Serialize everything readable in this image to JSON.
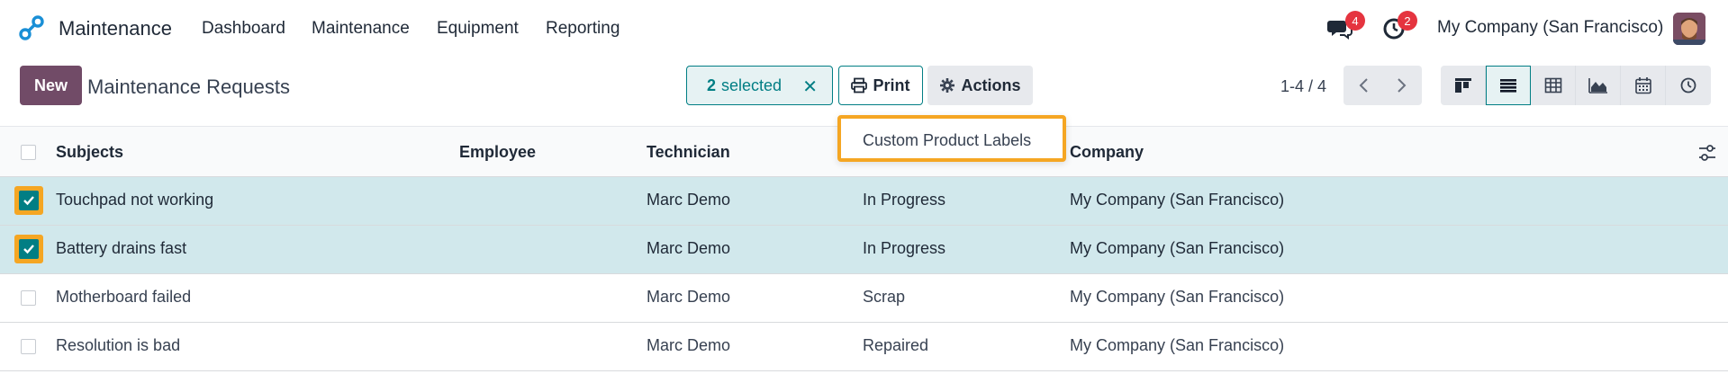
{
  "app": {
    "name": "Maintenance",
    "brand_color": "#714b67",
    "accent_color": "#017e84",
    "logo_icon": "maintenance-logo-icon"
  },
  "topnav": {
    "menu": [
      {
        "label": "Dashboard"
      },
      {
        "label": "Maintenance"
      },
      {
        "label": "Equipment"
      },
      {
        "label": "Reporting"
      }
    ],
    "chat_badge": "4",
    "activity_badge": "2",
    "company": "My Company (San Francisco)"
  },
  "control_panel": {
    "new_label": "New",
    "breadcrumb": "Maintenance Requests",
    "selected_count": "2",
    "selected_label": "selected",
    "print_label": "Print",
    "actions_label": "Actions",
    "pager": "1-4 / 4",
    "views": [
      "kanban-view-icon",
      "list-view-icon",
      "pivot-view-icon",
      "graph-view-icon",
      "calendar-view-icon",
      "activity-view-icon"
    ],
    "active_view": "list-view-icon"
  },
  "print_menu": {
    "items": [
      {
        "label": "Custom Product Labels"
      }
    ]
  },
  "table": {
    "headers": {
      "subject": "Subjects",
      "employee": "Employee",
      "technician": "Technician",
      "company": "Company"
    },
    "rows": [
      {
        "subject": "Touchpad not working",
        "employee": "",
        "technician": "Marc Demo",
        "stage": "In Progress",
        "company": "My Company (San Francisco)",
        "selected": true
      },
      {
        "subject": "Battery drains fast",
        "employee": "",
        "technician": "Marc Demo",
        "stage": "In Progress",
        "company": "My Company (San Francisco)",
        "selected": true
      },
      {
        "subject": "Motherboard failed",
        "employee": "",
        "technician": "Marc Demo",
        "stage": "Scrap",
        "company": "My Company (San Francisco)",
        "selected": false
      },
      {
        "subject": "Resolution is bad",
        "employee": "",
        "technician": "Marc Demo",
        "stage": "Repaired",
        "company": "My Company (San Francisco)",
        "selected": false
      }
    ]
  }
}
